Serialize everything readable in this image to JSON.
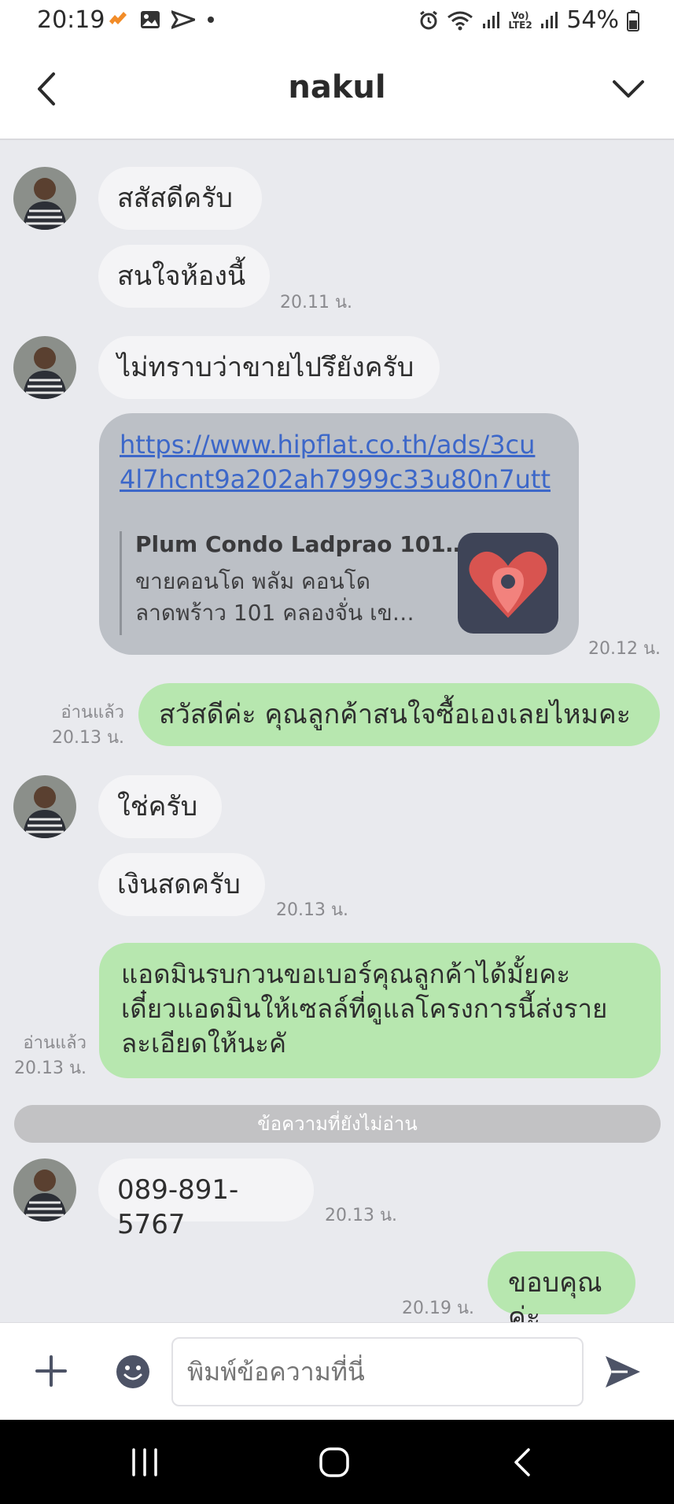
{
  "status_bar": {
    "time": "20:19",
    "battery": "54%",
    "network": "Vo) LTE2"
  },
  "header": {
    "title": "nakul"
  },
  "messages": [
    {
      "text": "สสัสดีครับ"
    },
    {
      "text": "สนใจห้องนี้",
      "time": "20.11 น."
    },
    {
      "text": "ไม่ทราบว่าขายไปรึยังครับ"
    },
    {
      "url": "https://www.hipflat.co.th/ads/3cu4l7hcnt9a202ah7999c33u80n7utt",
      "url_line1": "https://www.hipflat.co.th/ads/3cu",
      "url_line2": "4l7hcnt9a202ah7999c33u80n7utt",
      "preview_title": "Plum Condo Ladprao 101…",
      "preview_desc_line1": "ขายคอนโด พลัม คอนโด",
      "preview_desc_line2": "ลาดพร้าว 101 คลองจั่น เข…",
      "time": "20.12 น."
    },
    {
      "text": "สวัสดีค่ะ คุณลูกค้าสนใจซื้อเองเลยไหมคะ",
      "read": "อ่านแล้ว",
      "time": "20.13 น."
    },
    {
      "text": "ใช่ครับ"
    },
    {
      "text": "เงินสดครับ",
      "time": "20.13 น."
    },
    {
      "line1": "แอดมินรบกวนขอเบอร์คุณลูกค้าได้มั้ยคะ",
      "line2": "เดี๋ยวแอดมินให้เซลล์ที่ดูแลโครงการนี้ส่งราย",
      "line3": "ละเอียดให้นะคั",
      "read": "อ่านแล้ว",
      "time": "20.13 น."
    },
    {
      "text": "089-891-5767",
      "time": "20.13 น."
    },
    {
      "text": "ขอบคุณค่ะ",
      "time": "20.19 น."
    }
  ],
  "unread_divider": "ข้อความที่ยังไม่อ่าน",
  "input": {
    "placeholder": "พิมพ์ข้อความที่นี่"
  },
  "colors": {
    "chat_background": "#e9eaee",
    "incoming_bubble": "#f4f4f6",
    "outgoing_bubble": "#b7e7af",
    "link_bubble": "#bcc0c6",
    "link_text": "#3c67c9",
    "thumb_background": "#3e4457",
    "heart": "#e8605c"
  },
  "icons": [
    "back-chevron-icon",
    "dropdown-chevron-icon",
    "plus-icon",
    "emoji-icon",
    "send-icon",
    "recent-apps-icon",
    "home-icon",
    "back-icon"
  ]
}
